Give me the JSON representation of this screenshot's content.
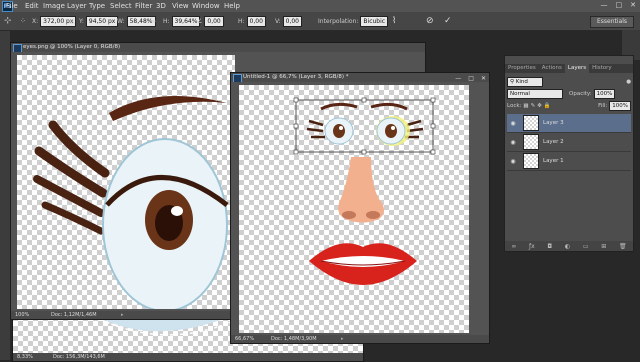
{
  "menubar": {
    "logo": "Ps",
    "items": [
      "File",
      "Edit",
      "Image",
      "Layer",
      "Type",
      "Select",
      "Filter",
      "3D",
      "View",
      "Window",
      "Help"
    ],
    "window_controls": [
      "—",
      "□",
      "✕"
    ]
  },
  "options": {
    "x_label": "X:",
    "x_value": "372,00 px",
    "y_label": "Y:",
    "y_value": "94,50 px",
    "w_label": "W:",
    "w_value": "58,48%",
    "h_label": "H:",
    "h_value": "39,64%",
    "angle_value": "0,00",
    "hskew_label": "H:",
    "hskew_value": "0,00",
    "vskew_label": "V:",
    "vskew_value": "0,00",
    "interp_label": "Interpolation:",
    "interp_value": "Bicubic",
    "workspace": "Essentials"
  },
  "doc_eyes": {
    "title": "eyes.png @ 100% (Layer 0, RGB/8)",
    "zoom": "100%",
    "doc_info": "Doc: 1,12M/1,46M"
  },
  "doc_back": {
    "zoom": "8,33%",
    "doc_info": "Doc: 156,3M/143,6M"
  },
  "doc_untitled": {
    "title": "Untitled-1 @ 66,7% (Layer 3, RGB/8) *",
    "zoom": "66,67%",
    "doc_info": "Doc: 1,48M/3,90M"
  },
  "panel": {
    "tabs": [
      "Properties",
      "Actions",
      "Layers",
      "History"
    ],
    "active_tab": "Layers",
    "kind_label": "Kind",
    "blend_mode": "Normal",
    "opacity_label": "Opacity:",
    "opacity_value": "100%",
    "lock_label": "Lock:",
    "fill_label": "Fill:",
    "fill_value": "100%",
    "layers": [
      {
        "name": "Layer 3",
        "active": true
      },
      {
        "name": "Layer 2",
        "active": false
      },
      {
        "name": "Layer 1",
        "active": false
      }
    ]
  },
  "colors": {
    "lip_red": "#d8231c",
    "iris_brown": "#6a3418",
    "skin": "#f2b08f",
    "selected_layer": "#5b6f8c"
  }
}
